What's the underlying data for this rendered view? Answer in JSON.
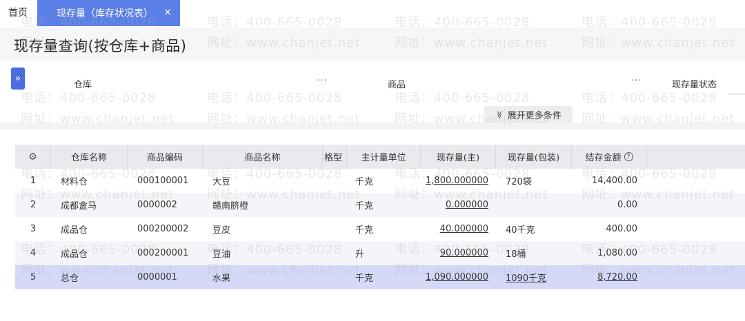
{
  "tabs": {
    "home_label": "首页",
    "active_label": "现存量（库存状况表）",
    "close_glyph": "×"
  },
  "page": {
    "title": "现存量查询(按仓库+商品)"
  },
  "filters": {
    "toggle_glyph": "»",
    "warehouse_label": "仓库",
    "product_label": "商品",
    "status_label": "现存量状态",
    "dots": "···",
    "more_label": "展开更多条件",
    "more_chevron": "≫"
  },
  "table": {
    "headers": {
      "settings_icon": "⚙",
      "warehouse": "仓库名称",
      "code": "商品编码",
      "name": "商品名称",
      "spec": "格型",
      "unit": "主计量单位",
      "qty_main": "现存量(主)",
      "qty_pack": "现存量(包装)",
      "amount": "结存金额",
      "help_icon": "?"
    },
    "rows": [
      {
        "idx": "1",
        "warehouse": "材料仓",
        "code": "000100001",
        "name": "大豆",
        "unit": "千克",
        "qty_main": "1,800.000000",
        "qty_pack": "720袋",
        "amount": "14,400.00"
      },
      {
        "idx": "2",
        "warehouse": "成都盒马",
        "code": "0000002",
        "name": "赣南脐橙",
        "unit": "千克",
        "qty_main": "0.000000",
        "qty_pack": "",
        "amount": "0.00"
      },
      {
        "idx": "3",
        "warehouse": "成品仓",
        "code": "000200002",
        "name": "豆皮",
        "unit": "千克",
        "qty_main": "40.000000",
        "qty_pack": "40千克",
        "amount": "400.00"
      },
      {
        "idx": "4",
        "warehouse": "成品仓",
        "code": "000200001",
        "name": "豆油",
        "unit": "升",
        "qty_main": "90.000000",
        "qty_pack": "18桶",
        "amount": "1,080.00"
      },
      {
        "idx": "5",
        "warehouse": "总仓",
        "code": "0000001",
        "name": "水果",
        "unit": "千克",
        "qty_main": "1,090.000000",
        "qty_pack": "1090千克",
        "amount": "8,720.00"
      }
    ]
  },
  "watermark": {
    "phone": "电话：400-665-0028",
    "site": "网址：www.chanjet.net"
  }
}
